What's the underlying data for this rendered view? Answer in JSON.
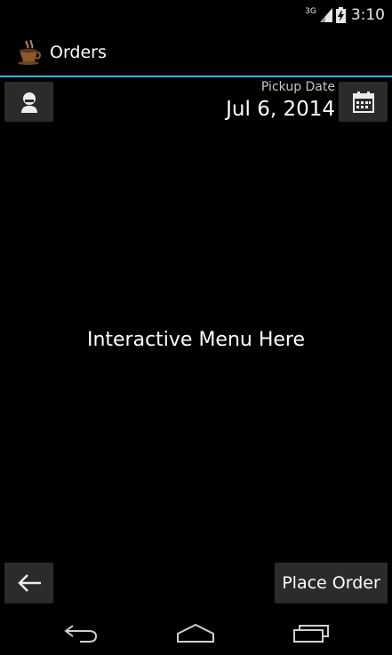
{
  "status_bar": {
    "network": "3G",
    "time": "3:10"
  },
  "action_bar": {
    "title": "Orders",
    "app_icon": "coffee-cup-icon"
  },
  "header": {
    "profile_icon": "person-icon",
    "pickup_label": "Pickup Date",
    "pickup_date": "Jul 6, 2014",
    "calendar_icon": "calendar-icon"
  },
  "main": {
    "placeholder": "Interactive Menu Here"
  },
  "footer": {
    "back_icon": "arrow-left-icon",
    "place_order_label": "Place Order"
  },
  "nav_bar": {
    "back_icon": "nav-back-icon",
    "home_icon": "nav-home-icon",
    "recents_icon": "nav-recents-icon"
  },
  "colors": {
    "background": "#000000",
    "accent": "#33b5e5",
    "button": "#2b2b2b"
  }
}
